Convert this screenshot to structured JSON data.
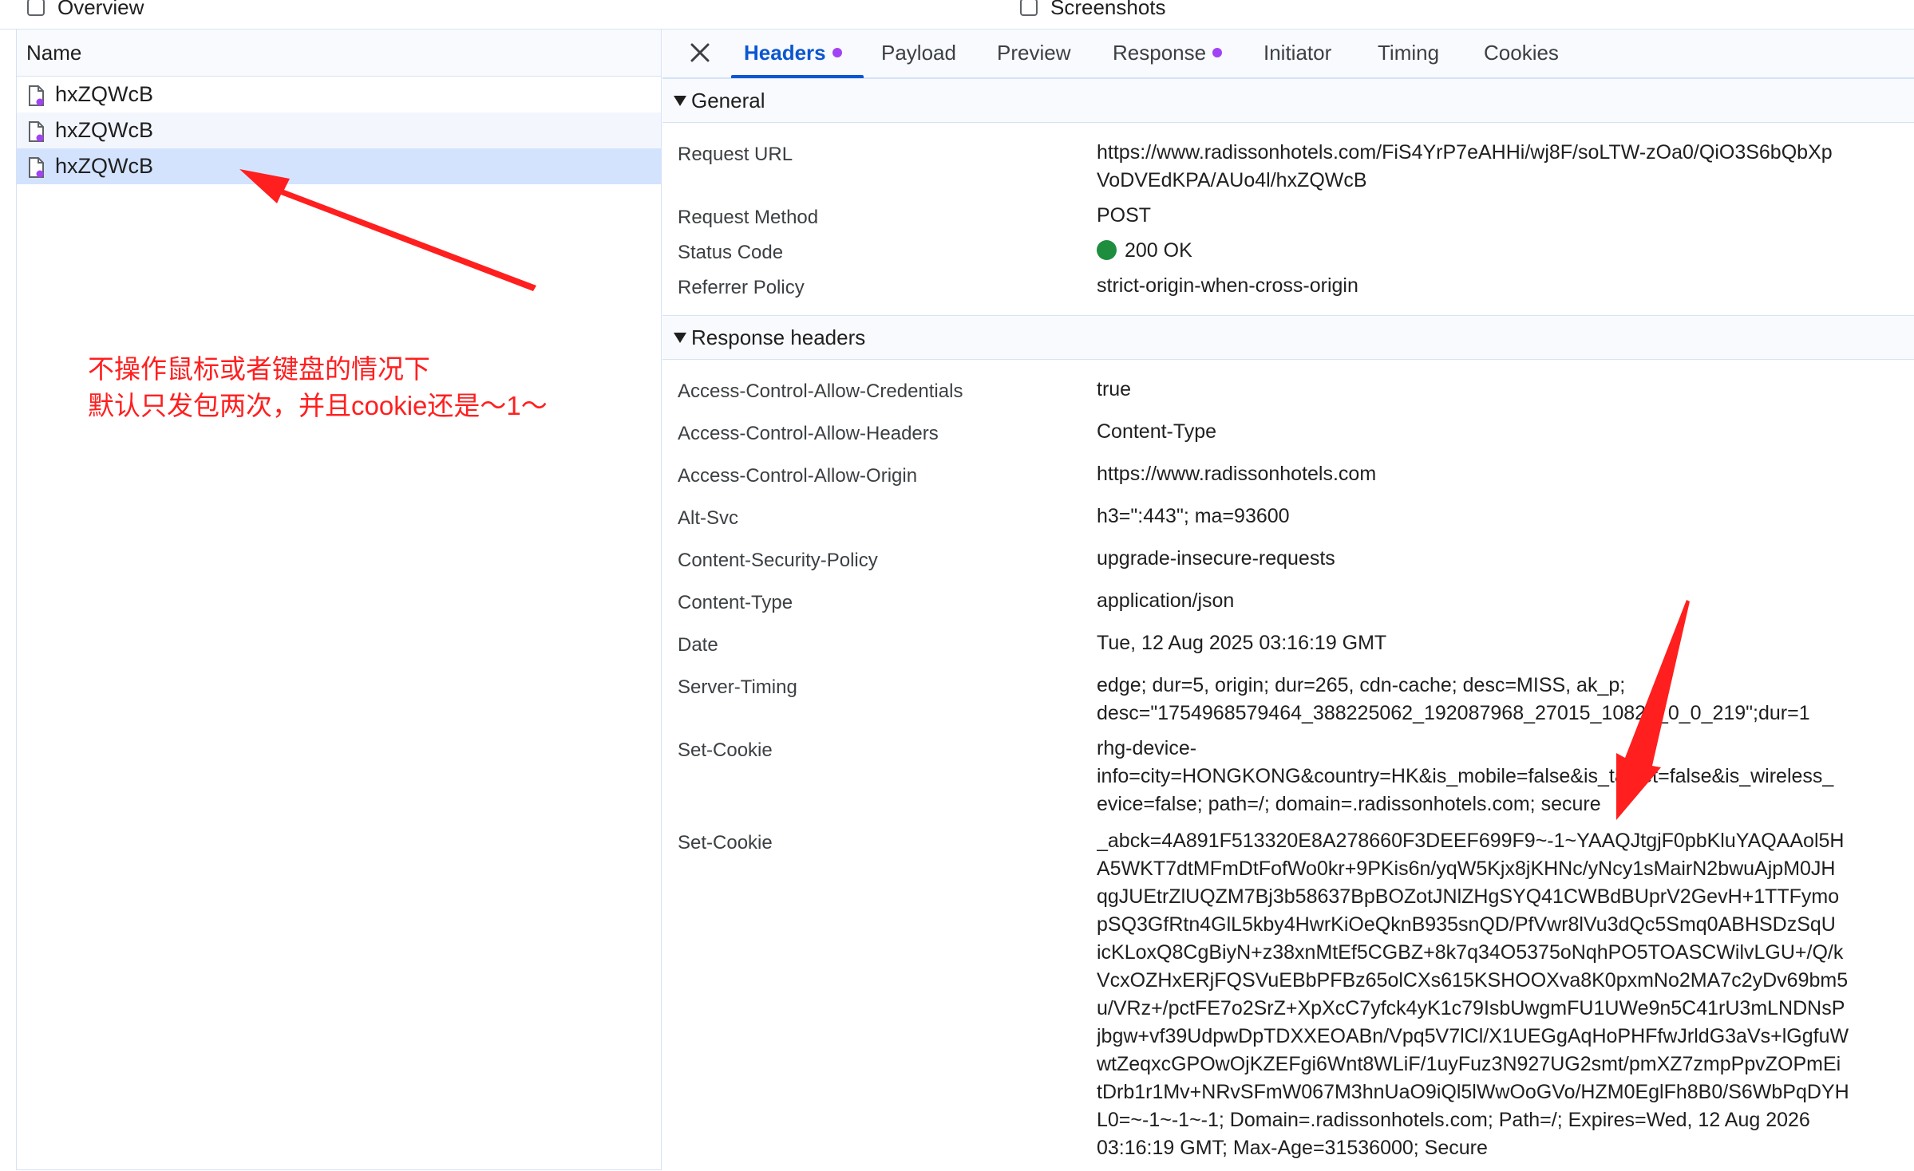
{
  "topbar": {
    "overview_label": "Overview",
    "screenshots_label": "Screenshots"
  },
  "requests": {
    "column_name": "Name",
    "items": [
      {
        "name": "hxZQWcB"
      },
      {
        "name": "hxZQWcB"
      },
      {
        "name": "hxZQWcB"
      }
    ]
  },
  "tabs": [
    {
      "label": "Headers"
    },
    {
      "label": "Payload"
    },
    {
      "label": "Preview"
    },
    {
      "label": "Response"
    },
    {
      "label": "Initiator"
    },
    {
      "label": "Timing"
    },
    {
      "label": "Cookies"
    }
  ],
  "general": {
    "title": "General",
    "request_url_key": "Request URL",
    "request_url_lines": [
      "https://www.radissonhotels.com/FiS4YrP7eAHHi/wj8F/soLTW-zOa0/QiO3S6bQbXp",
      "VoDVEdKPA/AUo4l/hxZQWcB"
    ],
    "method_key": "Request Method",
    "method_val": "POST",
    "status_key": "Status Code",
    "status_val": "200 OK",
    "referrer_key": "Referrer Policy",
    "referrer_val": "strict-origin-when-cross-origin",
    "status_color": "#1e8e3e"
  },
  "response": {
    "title": "Response headers",
    "h1_key": "Access-Control-Allow-Credentials",
    "h1_val": "true",
    "h2_key": "Access-Control-Allow-Headers",
    "h2_val": "Content-Type",
    "h3_key": "Access-Control-Allow-Origin",
    "h3_val": "https://www.radissonhotels.com",
    "h4_key": "Alt-Svc",
    "h4_val": "h3=\":443\"; ma=93600",
    "h5_key": "Content-Security-Policy",
    "h5_val": "upgrade-insecure-requests",
    "h6_key": "Content-Type",
    "h6_val": "application/json",
    "h7_key": "Date",
    "h7_val": "Tue, 12 Aug 2025 03:16:19 GMT",
    "h8_key": "Server-Timing",
    "h8_lines": [
      "edge; dur=5, origin; dur=265, cdn-cache; desc=MISS, ak_p;",
      "desc=\"1754968579464_388225062_192087968_27015_10829_0_0_219\";dur=1"
    ],
    "h9_key": "Set-Cookie",
    "h9_lines": [
      "rhg-device-",
      "info=city=HONGKONG&country=HK&is_mobile=false&is_tablet=false&is_wireless_",
      "evice=false; path=/; domain=.radissonhotels.com; secure"
    ],
    "h10_key": "Set-Cookie",
    "h10_lines": [
      "_abck=4A891F513320E8A278660F3DEEF699F9~-1~YAAQJtgjF0pbKluYAQAAol5H",
      "A5WKT7dtMFmDtFofWo0kr+9PKis6n/yqW5Kjx8jKHNc/yNcy1sMairN2bwuAjpM0JH",
      "qgJUEtrZlUQZM7Bj3b58637BpBOZotJNlZHgSYQ41CWBdBUprV2GevH+1TTFymo",
      "pSQ3GfRtn4GlL5kby4HwrKiOeQknB935snQD/PfVwr8lVu3dQc5Smq0ABHSDzSqU",
      "icKLoxQ8CgBiyN+z38xnMtEf5CGBZ+8k7q34O5375oNqhPO5TOASCWilvLGU+/Q/k",
      "VcxOZHxERjFQSVuEBbPFBz65olCXs615KSHOOXva8K0pxmNo2MA7c2yDv69bm5",
      "u/VRz+/pctFE7o2SrZ+XpXcC7yfck4yK1c79IsbUwgmFU1UWe9n5C41rU3mLNDNsP",
      "jbgw+vf39UdpwDpTDXXEOABn/Vpq5V7lCl/X1UEGgAqHoPHFfwJrldG3aVs+lGgfuW",
      "wtZeqxcGPOwOjKZEFgi6Wnt8WLiF/1uyFuz3N927UG2smt/pmXZ7zmpPpvZOPmEi",
      "tDrb1r1Mv+NRvSFmW067M3hnUaO9iQl5lWwOoGVo/HZM0EglFh8B0/S6WbPqDYH",
      "L0=~-1~-1~-1; Domain=.radissonhotels.com; Path=/; Expires=Wed, 12 Aug 2026",
      "03:16:19 GMT; Max-Age=31536000; Secure"
    ]
  },
  "annotation": {
    "line1": "不操作鼠标或者键盘的情况下",
    "line2": "默认只发包两次，并且cookie还是～1～",
    "color": "#ff1f1f"
  },
  "colors": {
    "accent": "#0b57d0",
    "selected_row": "#d3e3fd",
    "tab_dot": "#a142f4"
  }
}
